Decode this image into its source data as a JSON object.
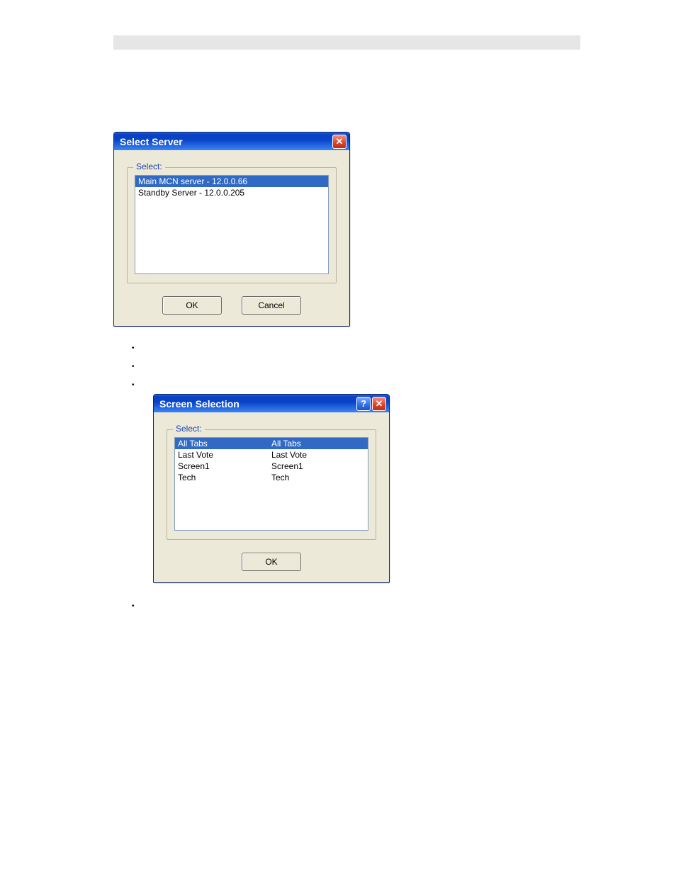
{
  "dialog1": {
    "title": "Select Server",
    "group_label": "Select:",
    "items": [
      "Main MCN server - 12.0.0.66",
      "Standby Server - 12.0.0.205"
    ],
    "selected_index": 0,
    "ok_label": "OK",
    "cancel_label": "Cancel"
  },
  "dialog2": {
    "title": "Screen Selection",
    "group_label": "Select:",
    "items": [
      {
        "c1": "All Tabs",
        "c2": "All Tabs"
      },
      {
        "c1": "Last Vote",
        "c2": "Last Vote"
      },
      {
        "c1": "Screen1",
        "c2": "Screen1"
      },
      {
        "c1": "Tech",
        "c2": "Tech"
      }
    ],
    "selected_index": 0,
    "ok_label": "OK"
  },
  "glyphs": {
    "close": "✕",
    "help": "?",
    "bullet": "•"
  }
}
